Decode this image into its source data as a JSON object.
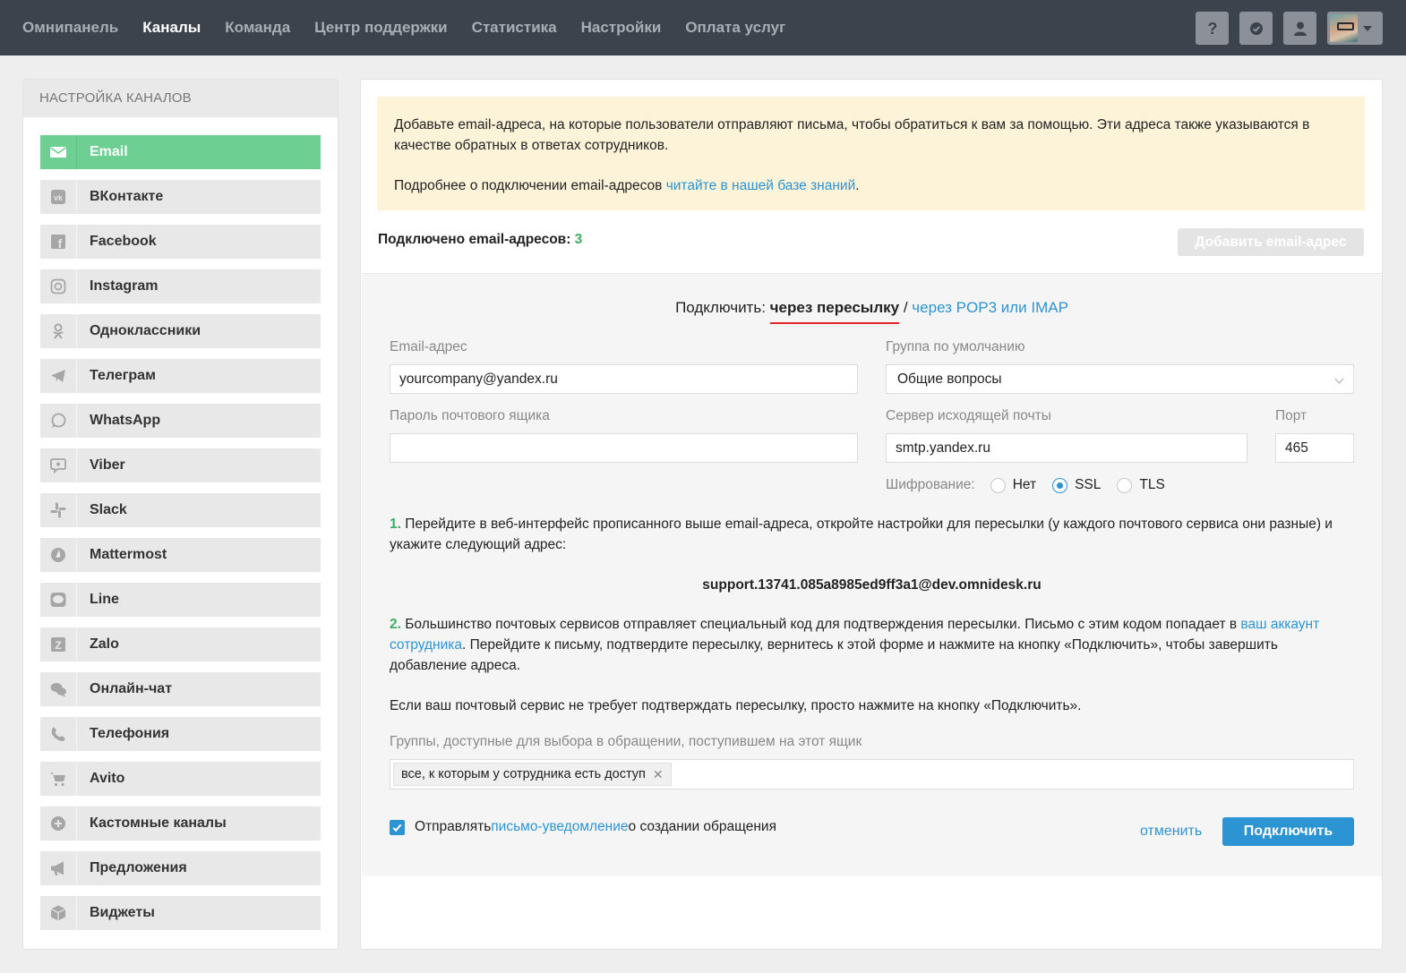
{
  "nav": {
    "items": [
      {
        "label": "Омнипанель"
      },
      {
        "label": "Каналы"
      },
      {
        "label": "Команда"
      },
      {
        "label": "Центр поддержки"
      },
      {
        "label": "Статистика"
      },
      {
        "label": "Настройки"
      },
      {
        "label": "Оплата услуг"
      }
    ],
    "active": "Каналы"
  },
  "sidebar": {
    "title": "НАСТРОЙКА КАНАЛОВ",
    "items": [
      {
        "label": "Email",
        "icon": "envelope-icon"
      },
      {
        "label": "ВКонтакте",
        "icon": "vk-icon"
      },
      {
        "label": "Facebook",
        "icon": "facebook-icon"
      },
      {
        "label": "Instagram",
        "icon": "instagram-icon"
      },
      {
        "label": "Одноклассники",
        "icon": "odnoklassniki-icon"
      },
      {
        "label": "Телеграм",
        "icon": "telegram-icon"
      },
      {
        "label": "WhatsApp",
        "icon": "whatsapp-icon"
      },
      {
        "label": "Viber",
        "icon": "viber-icon"
      },
      {
        "label": "Slack",
        "icon": "slack-icon"
      },
      {
        "label": "Mattermost",
        "icon": "mattermost-icon"
      },
      {
        "label": "Line",
        "icon": "line-icon"
      },
      {
        "label": "Zalo",
        "icon": "zalo-icon"
      },
      {
        "label": "Онлайн-чат",
        "icon": "chat-bubbles-icon"
      },
      {
        "label": "Телефония",
        "icon": "phone-icon"
      },
      {
        "label": "Avito",
        "icon": "cart-icon"
      },
      {
        "label": "Кастомные каналы",
        "icon": "plus-circle-icon"
      },
      {
        "label": "Предложения",
        "icon": "megaphone-icon"
      },
      {
        "label": "Виджеты",
        "icon": "cube-icon"
      }
    ],
    "active": "Email"
  },
  "notice": {
    "text1": "Добавьте email-адреса, на которые пользователи отправляют письма, чтобы обратиться к вам за помощью. Эти адреса также указываются в качестве обратных в ответах сотрудников.",
    "text2_prefix": "Подробнее о подключении email-адресов ",
    "text2_link": "читайте в нашей базе знаний",
    "text2_suffix": "."
  },
  "connected": {
    "label": "Подключено email-адресов:",
    "count": "3",
    "add_button": "Добавить email-адрес"
  },
  "connect": {
    "prefix": "Подключить:",
    "current": "через пересылку",
    "separator": "/",
    "alt": "через POP3 или IMAP"
  },
  "form": {
    "email_label": "Email-адрес",
    "email_value": "yourcompany@yandex.ru",
    "group_label": "Группа по умолчанию",
    "group_value": "Общие вопросы",
    "password_label": "Пароль почтового ящика",
    "password_value": "",
    "smtp_label": "Сервер исходящей почты",
    "smtp_value": "smtp.yandex.ru",
    "port_label": "Порт",
    "port_value": "465",
    "encryption_label": "Шифрование:",
    "encryption_options": [
      "Нет",
      "SSL",
      "TLS"
    ],
    "encryption_selected": "SSL"
  },
  "instructions": {
    "step1_num": "1.",
    "step1_text": "Перейдите в веб-интерфейс прописанного выше email-адреса, откройте настройки для пересылки (у каждого почтового сервиса они разные) и укажите следующий адрес:",
    "forward_address": "support.13741.085a8985ed9ff3a1@dev.omnidesk.ru",
    "step2_num": "2.",
    "step2_prefix": "Большинство почтовых сервисов отправляет специальный код для подтверждения пересылки. Письмо с этим кодом попадает в ",
    "step2_link": "ваш аккаунт сотрудника",
    "step2_suffix": ". Перейдите к письму, подтвердите пересылку, вернитесь к этой форме и нажмите на кнопку «Подключить», чтобы завершить добавление адреса.",
    "note": "Если ваш почтовый сервис не требует подтверждать пересылку, просто нажмите на кнопку «Подключить»."
  },
  "groups": {
    "label": "Группы, доступные для выбора в обращении, поступившем на этот ящик",
    "tag": "все, к которым у сотрудника есть доступ"
  },
  "footer": {
    "notify_prefix": "Отправлять ",
    "notify_link": "письмо-уведомление",
    "notify_suffix": " о создании обращения",
    "notify_checked": true,
    "cancel": "отменить",
    "submit": "Подключить"
  },
  "colors": {
    "topbar": "#3d434d",
    "active_channel": "#6ecf93",
    "link": "#2d94d3",
    "accent_green": "#3fae64",
    "notice_bg": "#fcf3d9",
    "primary_button": "#2d94d3"
  }
}
